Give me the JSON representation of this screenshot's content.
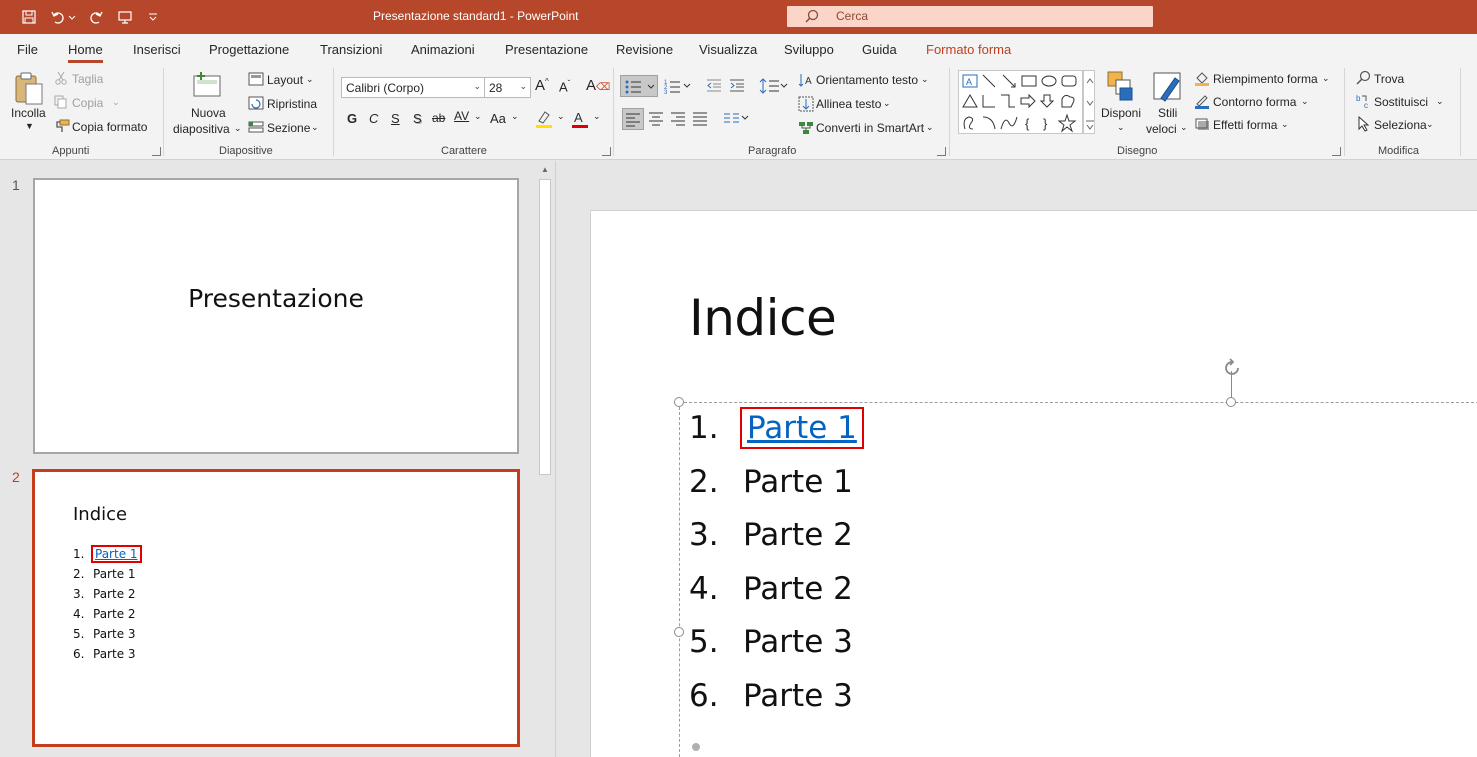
{
  "window": {
    "title": "Presentazione standard1  -  PowerPoint",
    "search_placeholder": "Cerca"
  },
  "tabs": [
    {
      "label": "File"
    },
    {
      "label": "Home"
    },
    {
      "label": "Inserisci"
    },
    {
      "label": "Progettazione"
    },
    {
      "label": "Transizioni"
    },
    {
      "label": "Animazioni"
    },
    {
      "label": "Presentazione"
    },
    {
      "label": "Revisione"
    },
    {
      "label": "Visualizza"
    },
    {
      "label": "Sviluppo"
    },
    {
      "label": "Guida"
    },
    {
      "label": "Formato forma"
    }
  ],
  "ribbon": {
    "appunti": {
      "label": "Appunti",
      "incolla": "Incolla",
      "taglia": "Taglia",
      "copia": "Copia",
      "copia_formato": "Copia formato"
    },
    "diapositive": {
      "label": "Diapositive",
      "nuova_line1": "Nuova",
      "nuova_line2": "diapositiva",
      "layout": "Layout",
      "ripristina": "Ripristina",
      "sezione": "Sezione"
    },
    "carattere": {
      "label": "Carattere",
      "font": "Calibri (Corpo)",
      "size": "28",
      "bold": "G",
      "italic": "C",
      "underline": "S",
      "shadow": "S",
      "strike": "ab",
      "spacing": "AV",
      "case": "Aa"
    },
    "paragrafo": {
      "label": "Paragrafo",
      "orientamento": "Orientamento testo",
      "allinea": "Allinea testo",
      "converti": "Converti in SmartArt"
    },
    "disegno": {
      "label": "Disegno",
      "disponi": "Disponi",
      "stili_line1": "Stili",
      "stili_line2": "veloci",
      "riempimento": "Riempimento forma",
      "contorno": "Contorno forma",
      "effetti": "Effetti forma"
    },
    "modifica": {
      "label": "Modifica",
      "trova": "Trova",
      "sostituisci": "Sostituisci",
      "seleziona": "Seleziona"
    }
  },
  "thumbnails": [
    {
      "number": "1",
      "title": "Presentazione"
    },
    {
      "number": "2",
      "title": "Indice",
      "items": [
        {
          "n": "1.",
          "text": "Parte 1"
        },
        {
          "n": "2.",
          "text": "Parte 1"
        },
        {
          "n": "3.",
          "text": "Parte 2"
        },
        {
          "n": "4.",
          "text": "Parte 2"
        },
        {
          "n": "5.",
          "text": "Parte 3"
        },
        {
          "n": "6.",
          "text": "Parte 3"
        }
      ]
    }
  ],
  "slide": {
    "title": "Indice",
    "items": [
      {
        "n": "1.",
        "text": "Parte 1"
      },
      {
        "n": "2.",
        "text": "Parte 1"
      },
      {
        "n": "3.",
        "text": "Parte 2"
      },
      {
        "n": "4.",
        "text": "Parte 2"
      },
      {
        "n": "5.",
        "text": "Parte 3"
      },
      {
        "n": "6.",
        "text": "Parte 3"
      }
    ]
  },
  "colors": {
    "accent": "#b7472a",
    "link": "#0563c1",
    "highlight_box": "#e00000"
  }
}
